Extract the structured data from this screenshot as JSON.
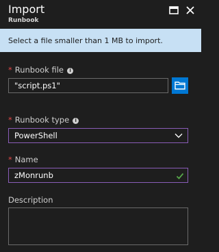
{
  "header": {
    "title": "Import",
    "subtitle": "Runbook",
    "maximize_icon": "maximize-icon",
    "close_icon": "close-icon"
  },
  "info_banner": {
    "text": "Select a file smaller than 1 MB to import."
  },
  "form": {
    "runbook_file": {
      "label": "Runbook file",
      "required_mark": "*",
      "value": "\"script.ps1\"",
      "browse_icon": "folder-icon"
    },
    "runbook_type": {
      "label": "Runbook type",
      "required_mark": "*",
      "selected": "PowerShell"
    },
    "name": {
      "label": "Name",
      "required_mark": "*",
      "value": "zMonrunb",
      "valid_icon": "checkmark-icon"
    },
    "description": {
      "label": "Description",
      "value": ""
    }
  },
  "colors": {
    "background": "#1e1e1e",
    "info_banner": "#c7e0f4",
    "required": "#e04848",
    "focus_border": "#8a5db8",
    "browse_button": "#0078d4",
    "valid_check": "#57a64a"
  }
}
